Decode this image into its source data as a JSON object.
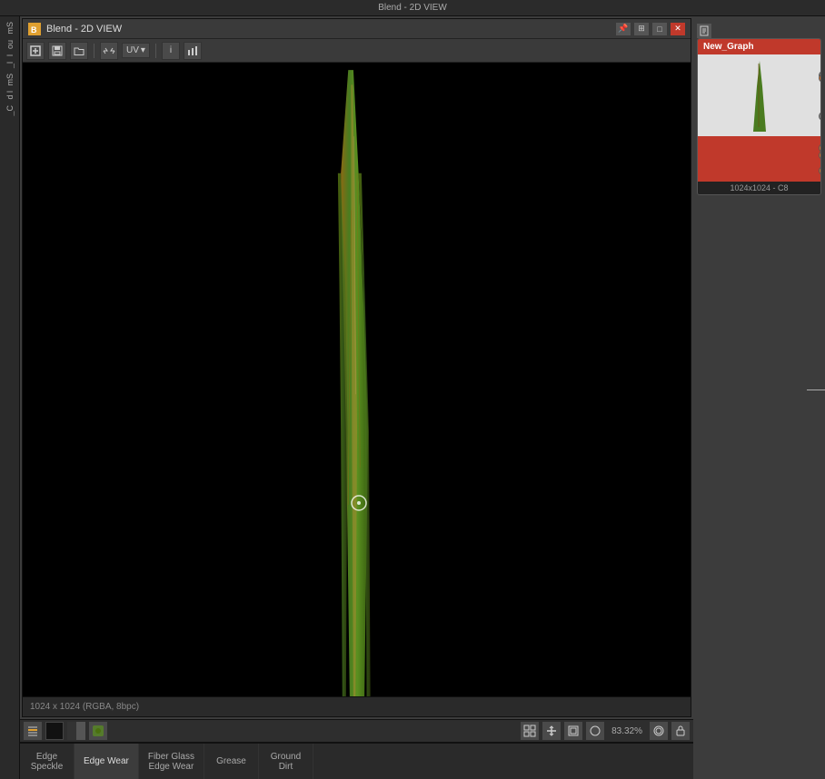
{
  "app": {
    "title": "Blend - 2D VIEW"
  },
  "window": {
    "title": "Blend - 2D VIEW"
  },
  "toolbar": {
    "uv_label": "UV",
    "info_label": "i",
    "chart_label": "📊"
  },
  "viewport": {
    "status": "1024 x 1024 (RGBA, 8bpc)",
    "zoom": "83.32%"
  },
  "node": {
    "title": "New_Graph",
    "size_label": "1024x1024 - C8"
  },
  "tabs": [
    {
      "id": "edge-speckle",
      "line1": "Edge",
      "line2": "Speckle",
      "active": false
    },
    {
      "id": "edge-wear",
      "line1": "Edge Wear",
      "line2": "",
      "active": true
    },
    {
      "id": "fiber-glass-edge-wear",
      "line1": "Fiber Glass",
      "line2": "Edge Wear",
      "active": false
    },
    {
      "id": "grease",
      "line1": "Grease",
      "line2": "",
      "active": false
    },
    {
      "id": "ground-dirt",
      "line1": "Ground",
      "line2": "Dirt",
      "active": false
    }
  ],
  "bottom_toolbar": {
    "zoom_label": "83.32%",
    "grid_icon": "grid",
    "layers_icon": "layers",
    "lock_icon": "lock"
  },
  "left_sidebar": {
    "items": [
      {
        "label": "mS"
      },
      {
        "label": "ou"
      },
      {
        "label": "l"
      },
      {
        "label": "_l"
      },
      {
        "label": "mS"
      },
      {
        "label": "d l"
      },
      {
        "label": "_C"
      }
    ]
  }
}
